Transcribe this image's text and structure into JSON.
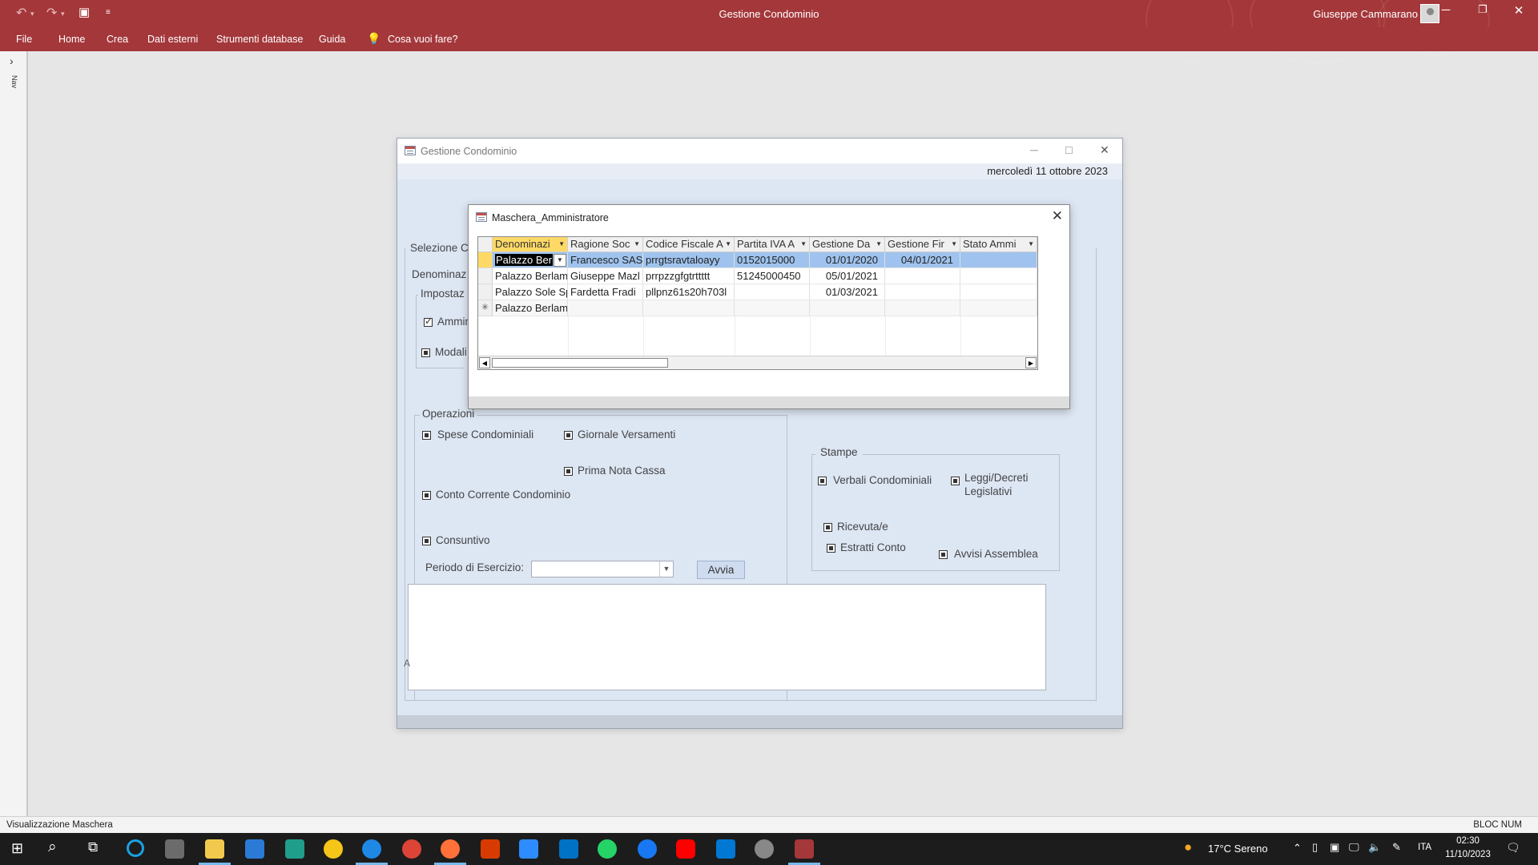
{
  "app": {
    "title": "Gestione Condominio",
    "user": "Giuseppe Cammarano",
    "ribbon_tabs": [
      "File",
      "Home",
      "Crea",
      "Dati esterni",
      "Strumenti database",
      "Guida"
    ],
    "tell_me": "Cosa vuoi fare?"
  },
  "nav_pane": {
    "label": "Nav"
  },
  "main_form": {
    "title": "Gestione Condominio",
    "date": "mercoledì 11 ottobre 2023",
    "selezione_label": "Selezione C",
    "denominazione_label": "Denominaz",
    "impostazioni_label": "Impostaz",
    "amministratore_label": "Ammin",
    "modalita_label": "Modali",
    "operazioni": {
      "label": "Operazioni",
      "spese": "Spese Condominiali",
      "giornale": "Giornale Versamenti",
      "prima_nota": "Prima Nota Cassa",
      "conto_corrente": "Conto Corrente Condominio",
      "consuntivo": "Consuntivo",
      "periodo_label": "Periodo di Esercizio:",
      "periodo_value": "",
      "avvia": "Avvia"
    },
    "stampe": {
      "label": "Stampe",
      "verbali": "Verbali Condominiali",
      "leggi": "Leggi/Decreti Legislativi",
      "ricevute": "Ricevuta/e",
      "estratti": "Estratti Conto",
      "avvisi": "Avvisi Assemblea"
    },
    "side_letter": "A"
  },
  "popup": {
    "title": "Maschera_Amministratore",
    "columns": [
      "Denominazi",
      "Ragione Soc",
      "Codice Fiscale A",
      "Partita IVA A",
      "Gestione Da",
      "Gestione Fir",
      "Stato Ammi"
    ],
    "rows": [
      [
        "Palazzo Ber",
        "Francesco SAS",
        "prrgtsravtaloayy",
        "0152015000",
        "01/01/2020",
        "04/01/2021",
        ""
      ],
      [
        "Palazzo Berlam",
        "Giuseppe Mazl",
        "prrpzzgfgtrttttt",
        "51245000450",
        "05/01/2021",
        "",
        ""
      ],
      [
        "Palazzo Sole Sp",
        "Fardetta Fradi",
        "pllpnz61s20h703l",
        "",
        "01/03/2021",
        "",
        ""
      ],
      [
        "Palazzo Berlam",
        "",
        "",
        "",
        "",
        "",
        ""
      ]
    ],
    "new_row_marker": "✳"
  },
  "statusbar": {
    "left": "Visualizzazione Maschera",
    "right": "BLOC NUM"
  },
  "taskbar": {
    "weather": "17°C  Sereno",
    "lang": "ITA",
    "time": "02:30",
    "date": "11/10/2023"
  },
  "colors": {
    "brand": "#a4373a",
    "form_bg": "#dde6f3",
    "selected_row": "#9fc3ee",
    "header_highlight": "#ffd966"
  }
}
